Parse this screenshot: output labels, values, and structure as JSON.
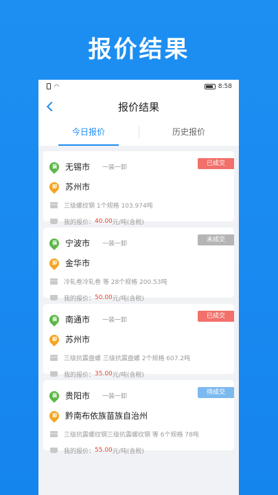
{
  "promo": {
    "title": "报价结果"
  },
  "statusbar": {
    "time": "8:58"
  },
  "navbar": {
    "title": "报价结果"
  },
  "tabs": [
    {
      "label": "今日报价",
      "active": true
    },
    {
      "label": "历史报价",
      "active": false
    }
  ],
  "quotes": [
    {
      "origin": "无锡市",
      "origin_pin": "装",
      "mode": "一装一卸",
      "destination": "苏州市",
      "dest_pin": "卸",
      "goods": "三级螺纹钢   1个规格 103.974吨",
      "price_label": "我的报价：",
      "price": "40.00",
      "price_unit": "元/吨(含税)",
      "status": "已成交",
      "status_color": "#f1706a"
    },
    {
      "origin": "宁波市",
      "origin_pin": "装",
      "mode": "一装一卸",
      "destination": "金华市",
      "dest_pin": "卸",
      "goods": "冷轧卷冷轧卷 等 28个规格 200.53吨",
      "price_label": "我的报价：",
      "price": "50.00",
      "price_unit": "元/吨(含税)",
      "status": "未成交",
      "status_color": "#b5b5b5"
    },
    {
      "origin": "南通市",
      "origin_pin": "装",
      "mode": "一装一卸",
      "destination": "苏州市",
      "dest_pin": "卸",
      "goods": "三级抗震盘螺 三级抗震盘螺  2个规格 607.2吨",
      "price_label": "我的报价：",
      "price": "35.00",
      "price_unit": "元/吨(含税)",
      "status": "已成交",
      "status_color": "#f1706a"
    },
    {
      "origin": "贵阳市",
      "origin_pin": "装",
      "mode": "一装一卸",
      "destination": "黔南布依族苗族自治州",
      "dest_pin": "卸",
      "goods": "三级抗震螺纹钢三级抗震螺纹钢 等 6个规格 78吨",
      "price_label": "我的报价：",
      "price": "55.00",
      "price_unit": "元/吨(含税)",
      "status": "待成交",
      "status_color": "#7cb9ef"
    }
  ]
}
